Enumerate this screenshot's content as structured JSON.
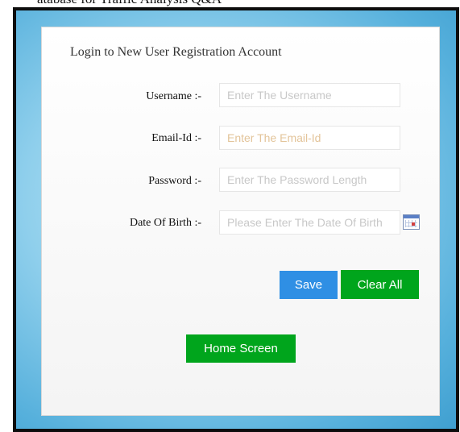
{
  "header_fragment": "atabase for Traffic Analysis Q&A",
  "form": {
    "title": "Login to New User Registration Account",
    "fields": [
      {
        "label": "Username :-",
        "placeholder": "Enter The Username",
        "value": ""
      },
      {
        "label": "Email-Id :-",
        "placeholder": "Enter The Email-Id",
        "value": ""
      },
      {
        "label": "Password :-",
        "placeholder": "Enter The Password Length",
        "value": ""
      },
      {
        "label": "Date Of Birth :-",
        "placeholder": "Please Enter The Date Of Birth",
        "value": ""
      }
    ],
    "buttons": {
      "save": "Save",
      "clear_all": "Clear All",
      "home_screen": "Home Screen"
    }
  },
  "colors": {
    "save_button": "#2f8fe4",
    "green_buttons": "#00a51c",
    "background": "#56b0dc"
  },
  "icons": {
    "date_picker": "calendar-icon"
  }
}
